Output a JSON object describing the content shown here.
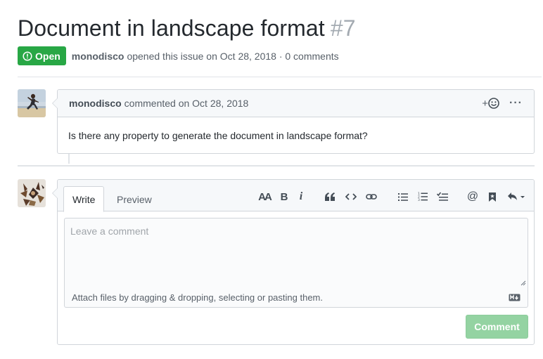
{
  "issue": {
    "title": "Document in landscape format",
    "number": "#7",
    "state_label": "Open",
    "author": "monodisco",
    "meta_text": "opened this issue on Oct 28, 2018 · 0 comments"
  },
  "comment": {
    "author": "monodisco",
    "meta_text": "commented on Oct 28, 2018",
    "reaction_label": "+",
    "more_label": "···",
    "body": "Is there any property to generate the document in landscape format?"
  },
  "form": {
    "tabs": [
      {
        "label": "Write",
        "active": true
      },
      {
        "label": "Preview",
        "active": false
      }
    ],
    "toolbar": {
      "heading_label": "AA",
      "bold_label": "B",
      "italic_label": "i",
      "mention_label": "@"
    },
    "textarea_placeholder": "Leave a comment",
    "attach_text": "Attach files by dragging & dropping, selecting or pasting them.",
    "submit_label": "Comment"
  },
  "colors": {
    "open_badge": "#28a745",
    "submit_disabled": "#94d3a2",
    "border": "#d1d5da",
    "header_bg": "#f6f8fa"
  }
}
